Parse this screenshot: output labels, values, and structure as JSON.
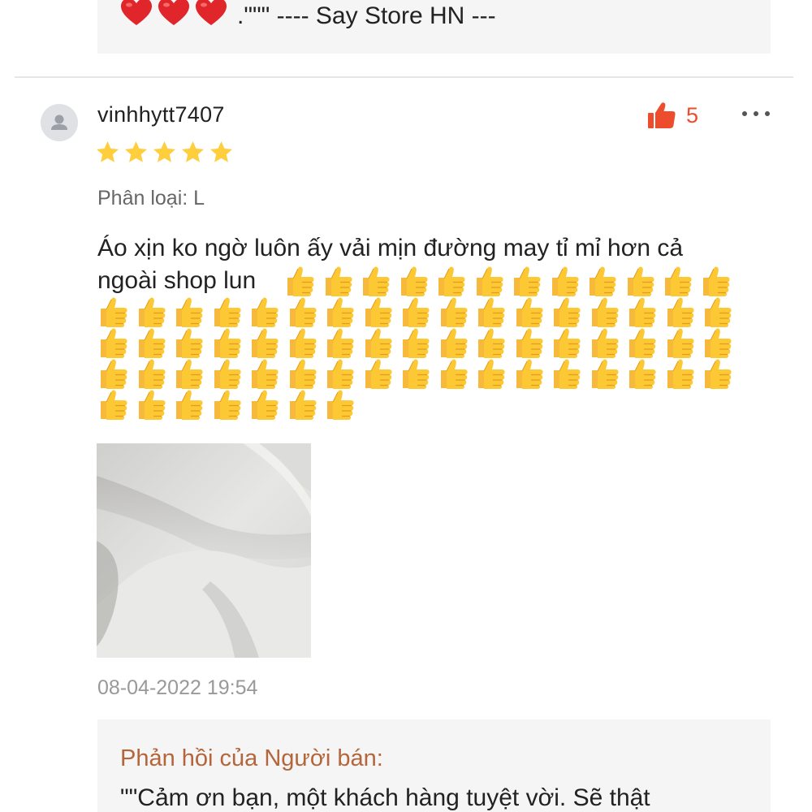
{
  "previous_reply": {
    "hearts": 3,
    "text": ".\"\"\" ---- Say Store HN ---"
  },
  "review": {
    "username": "vinhhytt7407",
    "rating": 5,
    "like_count": "5",
    "variation": "Phân loại: L",
    "comment_text": "Áo xịn ko ngờ luôn ấy vải mịn đường may tỉ mỉ hơn cả ngoài shop lun",
    "thumbs_up_count": 70,
    "timestamp": "08-04-2022 19:54",
    "icons": {
      "avatar": "default-user-icon",
      "like": "thumbs-up-icon",
      "more": "more-options-icon",
      "star": "star-icon",
      "emoji": "thumbs-up-emoji-icon"
    }
  },
  "seller_reply": {
    "label": "Phản hồi của Người bán:",
    "text": "\"\"Cảm ơn bạn, một khách hàng tuyệt vời. Sẽ thật"
  },
  "colors": {
    "accent": "#ee4d2d",
    "star": "#ffce3d",
    "seller_label": "#b4663a",
    "reply_bg": "#f5f5f5"
  }
}
